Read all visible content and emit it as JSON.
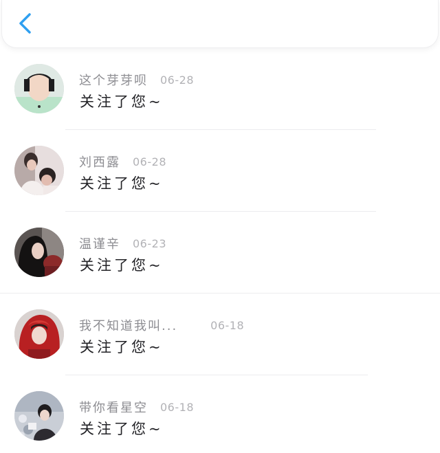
{
  "header": {
    "back_icon": "chevron-left-icon",
    "accent_color": "#2f9ff0"
  },
  "notifications": [
    {
      "username": "这个芽芽呗",
      "date": "06-28",
      "action": "关注了您~"
    },
    {
      "username": "刘西露",
      "date": "06-28",
      "action": "关注了您~"
    },
    {
      "username": "温谨辛",
      "date": "06-23",
      "action": "关注了您~"
    },
    {
      "username": "我不知道我叫...",
      "date": "06-18",
      "action": "关注了您~"
    },
    {
      "username": "带你看星空",
      "date": "06-18",
      "action": "关注了您~"
    }
  ]
}
